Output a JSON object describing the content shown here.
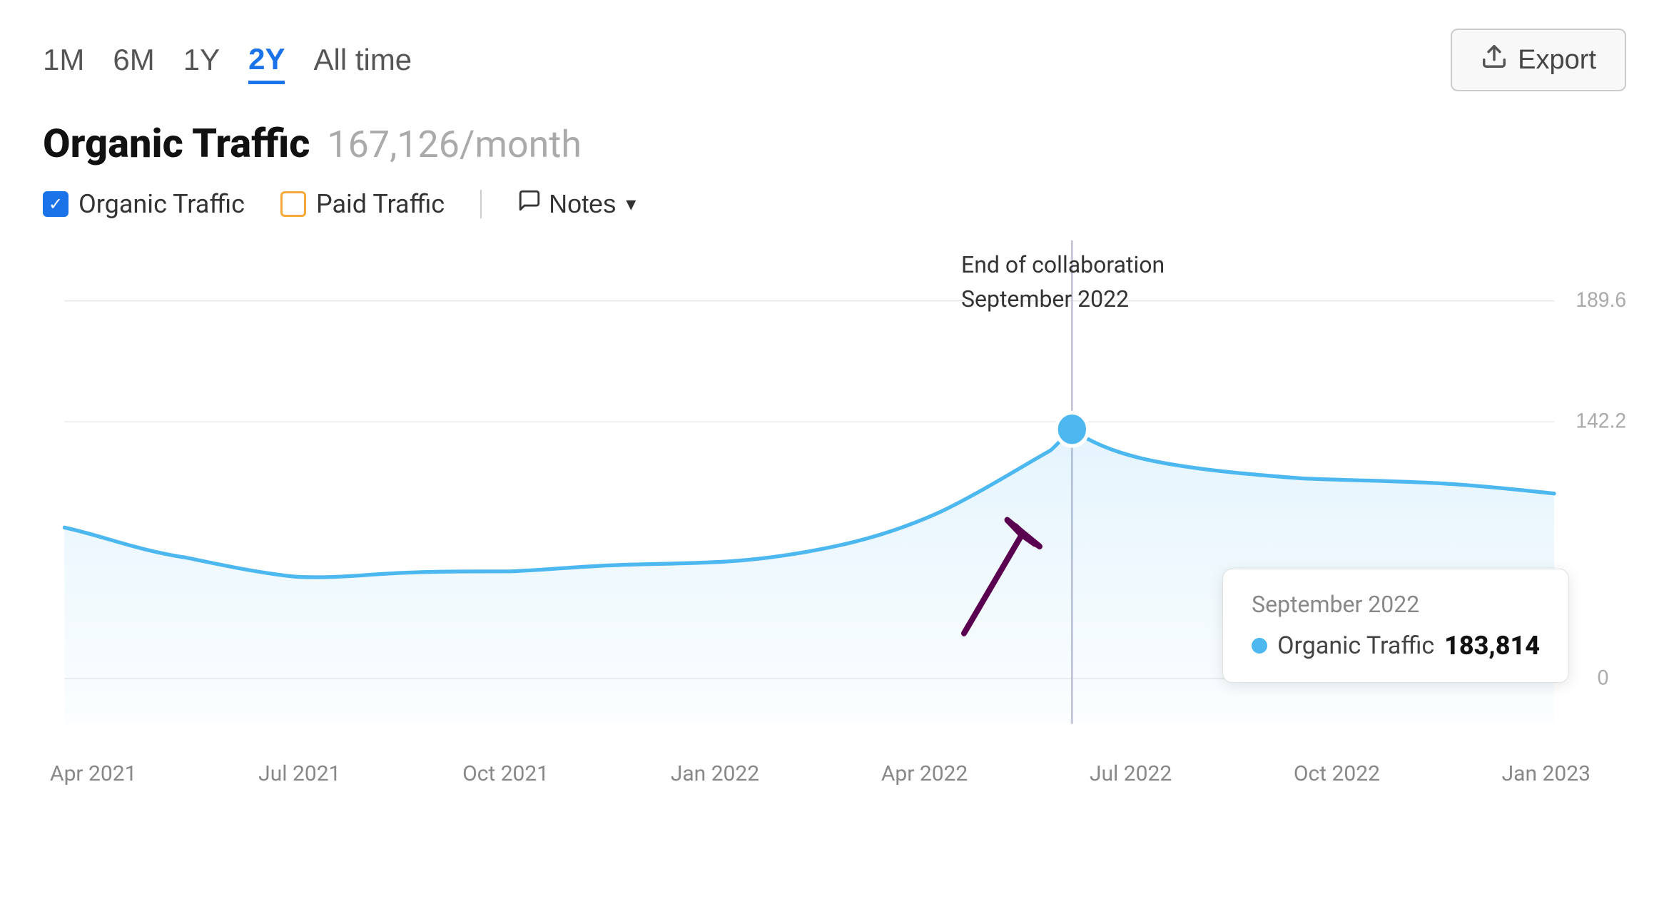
{
  "timeFilters": {
    "options": [
      "1M",
      "6M",
      "1Y",
      "2Y",
      "All time"
    ],
    "active": "2Y"
  },
  "exportButton": {
    "label": "Export"
  },
  "metric": {
    "label": "Organic Traffic",
    "value": "167,126/month"
  },
  "legend": {
    "items": [
      {
        "id": "organic",
        "label": "Organic Traffic",
        "checked": true,
        "color": "#1a73e8"
      },
      {
        "id": "paid",
        "label": "Paid Traffic",
        "checked": false,
        "color": "#f4a93a"
      }
    ],
    "notesLabel": "Notes"
  },
  "annotation": {
    "line1": "End of collaboration",
    "line2": "September 2022"
  },
  "tooltip": {
    "date": "September 2022",
    "metricName": "Organic Traffic",
    "metricValue": "183,814"
  },
  "yAxis": {
    "labels": [
      "189.6K",
      "142.2K",
      "0"
    ]
  },
  "xAxis": {
    "labels": [
      "Apr 2021",
      "Jul 2021",
      "Oct 2021",
      "Jan 2022",
      "Apr 2022",
      "Jul 2022",
      "Oct 2022",
      "Jan 2023"
    ]
  },
  "icons": {
    "checkmark": "✓",
    "exportArrow": "⬆",
    "notesIcon": "💬",
    "chevronDown": "▾"
  }
}
